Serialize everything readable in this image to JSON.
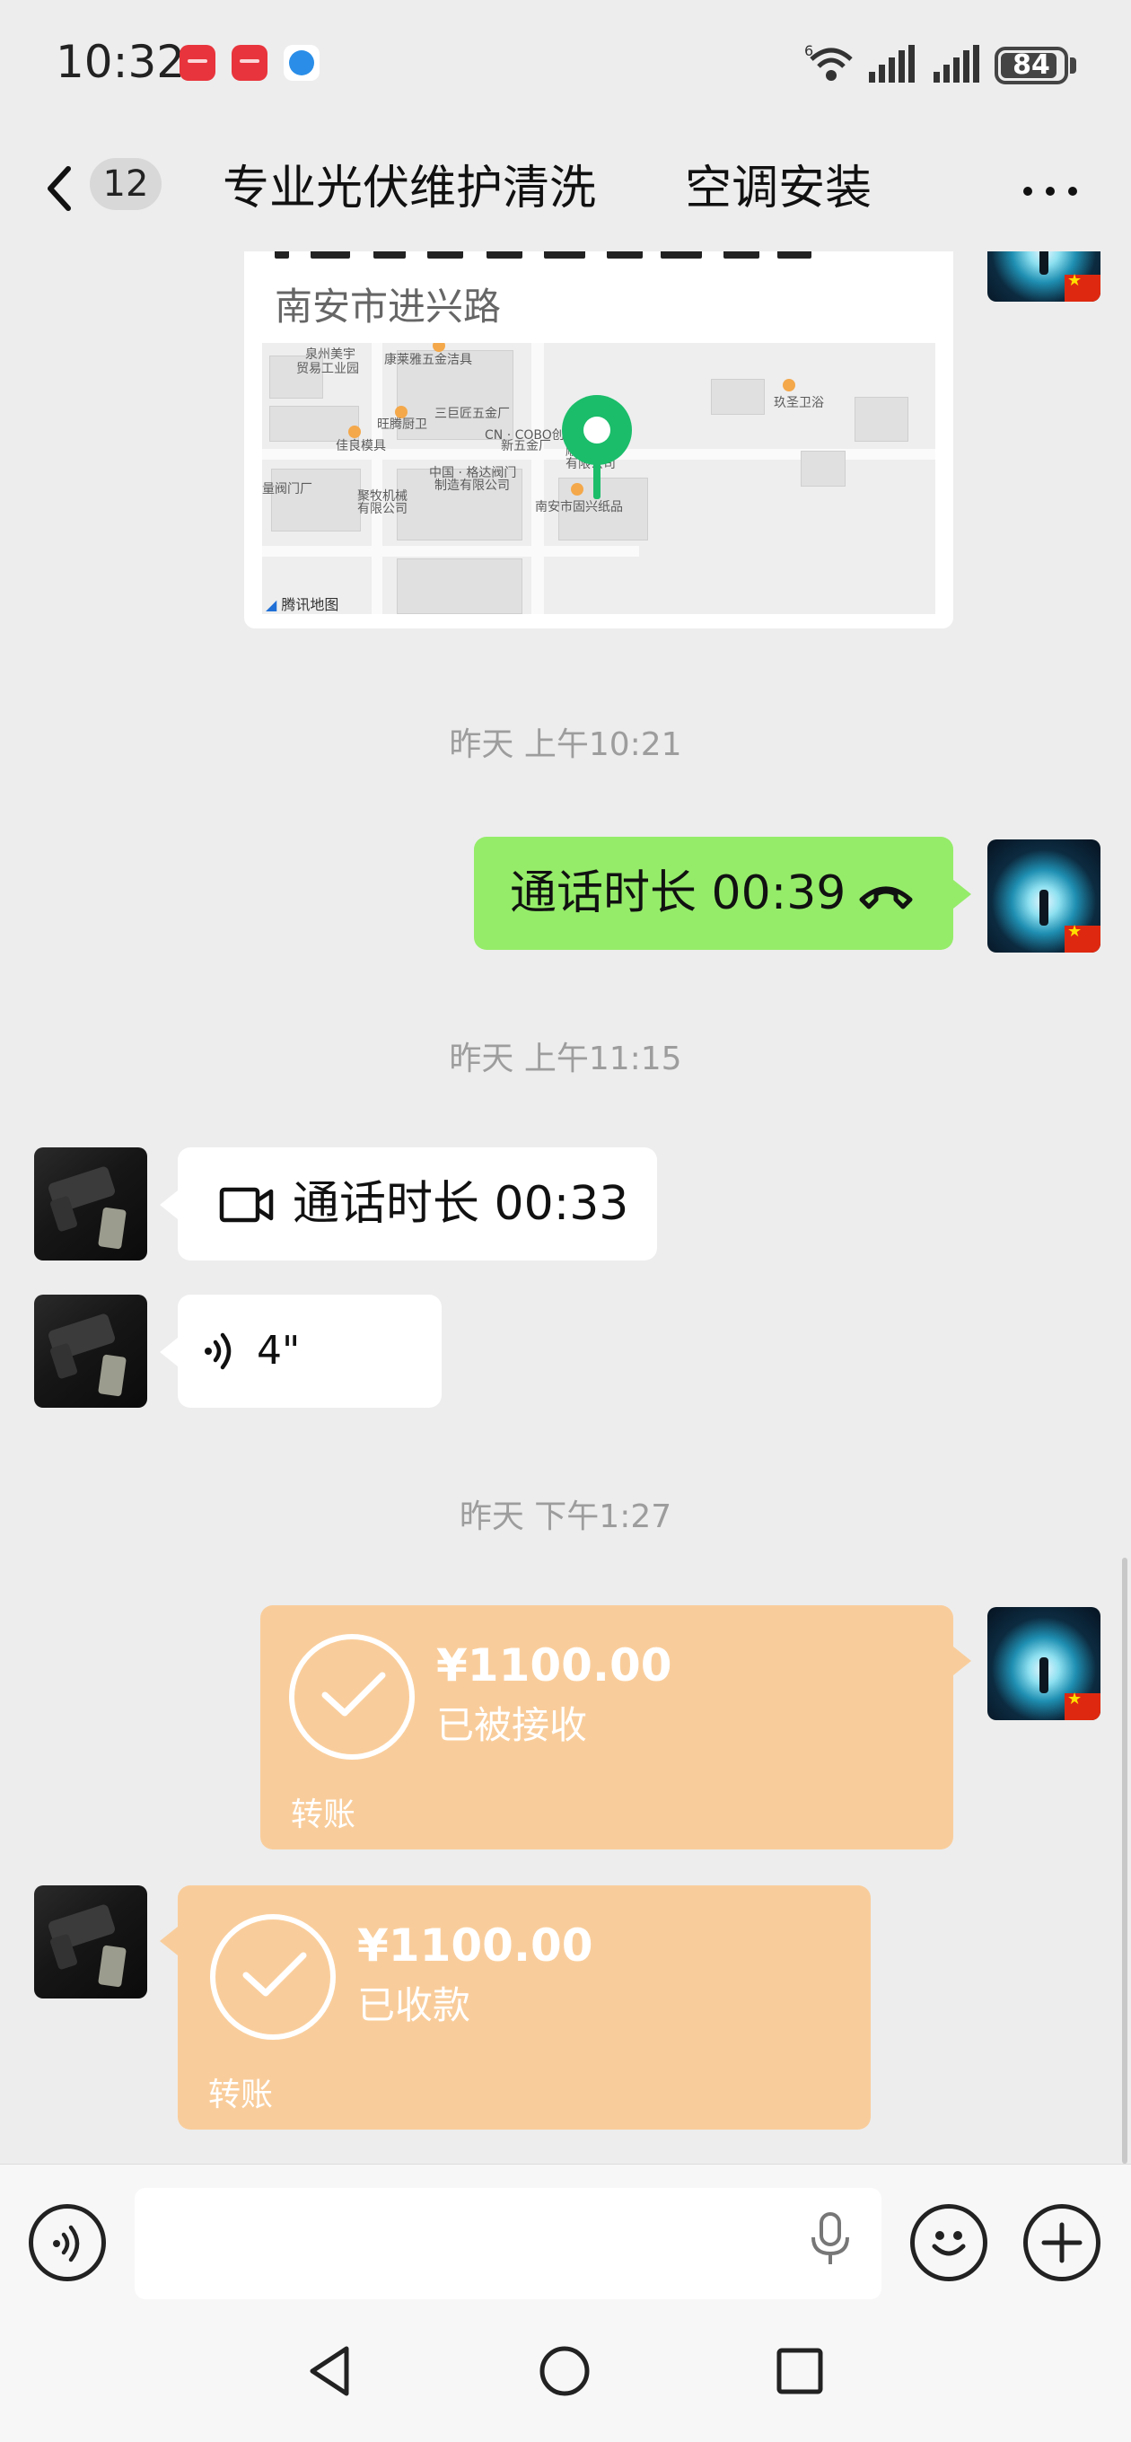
{
  "status_bar": {
    "time": "10:32",
    "app_icons": [
      "huawei-appgallery-icon",
      "huawei-appgallery-icon",
      "browser-icon"
    ],
    "network_type": "6",
    "battery": "84"
  },
  "header": {
    "unread_count": "12",
    "title": "专业光伏维护清洗      空调安装"
  },
  "messages": {
    "location": {
      "address": "南安市进兴路",
      "map_labels": {
        "l1": "泉州美宇",
        "l2": "贸易工业园",
        "l3": "康莱雅五金洁具",
        "l4": "三巨匠五金厂",
        "l5": "旺腾厨卫",
        "l6": "佳良模具",
        "l7": "CN · COBO创",
        "l8": "新五金厂",
        "l9": "顺捷管业",
        "l10": "有限公司",
        "l11": "玖圣卫浴",
        "l12": "中国 · 格达阀门",
        "l13": "制造有限公司",
        "l14": "量阀门厂",
        "l15": "聚牧机械",
        "l16": "有限公司",
        "l17": "南安市固兴纸品"
      },
      "map_attribution": "腾讯地图"
    },
    "ts1": "昨天 上午10:21",
    "voice_call_out": "通话时长 00:39",
    "ts2": "昨天 上午11:15",
    "video_call_in": "通话时长 00:33",
    "voice_msg": "4\"",
    "ts3": "昨天 下午1:27",
    "transfer_out": {
      "amount": "¥1100.00",
      "status": "已被接收",
      "label": "转账"
    },
    "transfer_in": {
      "amount": "¥1100.00",
      "status": "已收款",
      "label": "转账"
    }
  },
  "colors": {
    "background": "#ededed",
    "green_bubble": "#95ec69",
    "transfer_bubble": "#f9cd9b",
    "map_pin": "#1bbd6a",
    "flag_red": "#de2910"
  }
}
